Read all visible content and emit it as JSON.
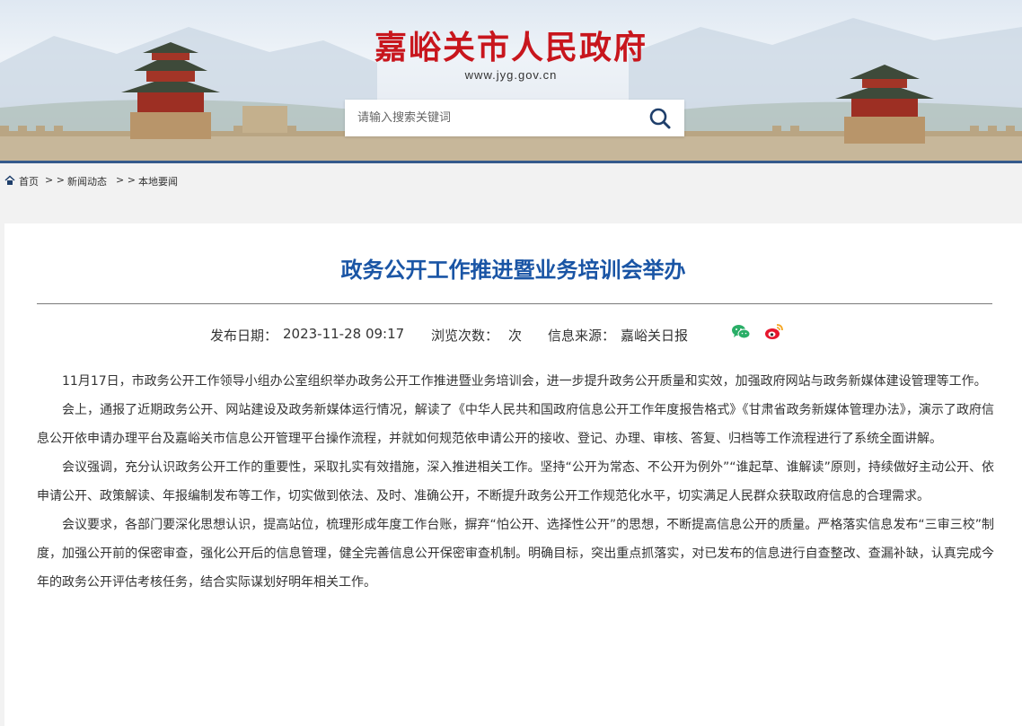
{
  "header": {
    "site_title": "嘉峪关市人民政府",
    "site_url": "www.jyg.gov.cn",
    "search_placeholder": "请输入搜索关键词"
  },
  "breadcrumb": {
    "home_icon": "home-icon",
    "items": [
      "首页",
      "新闻动态",
      "本地要闻"
    ],
    "separator": "> >"
  },
  "article": {
    "title": "政务公开工作推进暨业务培训会举办",
    "publish_label": "发布日期：",
    "publish_date": "2023-11-28 09:17",
    "views_label": "浏览次数：",
    "views_value": "次",
    "source_label": "信息来源：",
    "source_value": "嘉峪关日报",
    "share_icons": [
      "wechat-icon",
      "weibo-icon"
    ],
    "paragraphs": [
      "11月17日，市政务公开工作领导小组办公室组织举办政务公开工作推进暨业务培训会，进一步提升政务公开质量和实效，加强政府网站与政务新媒体建设管理等工作。",
      "会上，通报了近期政务公开、网站建设及政务新媒体运行情况，解读了《中华人民共和国政府信息公开工作年度报告格式》《甘肃省政务新媒体管理办法》，演示了政府信息公开依申请办理平台及嘉峪关市信息公开管理平台操作流程，并就如何规范依申请公开的接收、登记、办理、审核、答复、归档等工作流程进行了系统全面讲解。",
      "会议强调，充分认识政务公开工作的重要性，采取扎实有效措施，深入推进相关工作。坚持“公开为常态、不公开为例外”“谁起草、谁解读”原则，持续做好主动公开、依申请公开、政策解读、年报编制发布等工作，切实做到依法、及时、准确公开，不断提升政务公开工作规范化水平，切实满足人民群众获取政府信息的合理需求。",
      "会议要求，各部门要深化思想认识，提高站位，梳理形成年度工作台账，摒弃“怕公开、选择性公开”的思想，不断提高信息公开的质量。严格落实信息发布“三审三校”制度，加强公开前的保密审查，强化公开后的信息管理，健全完善信息公开保密审查机制。明确目标，突出重点抓落实，对已发布的信息进行自查整改、查漏补缺，认真完成今年的政务公开评估考核任务，结合实际谋划好明年相关工作。"
    ]
  },
  "colors": {
    "title_red": "#c8161d",
    "article_title_blue": "#1a55a5",
    "header_rule": "#355a8c",
    "wechat_green": "#2aae67",
    "weibo_red": "#e6162d"
  }
}
